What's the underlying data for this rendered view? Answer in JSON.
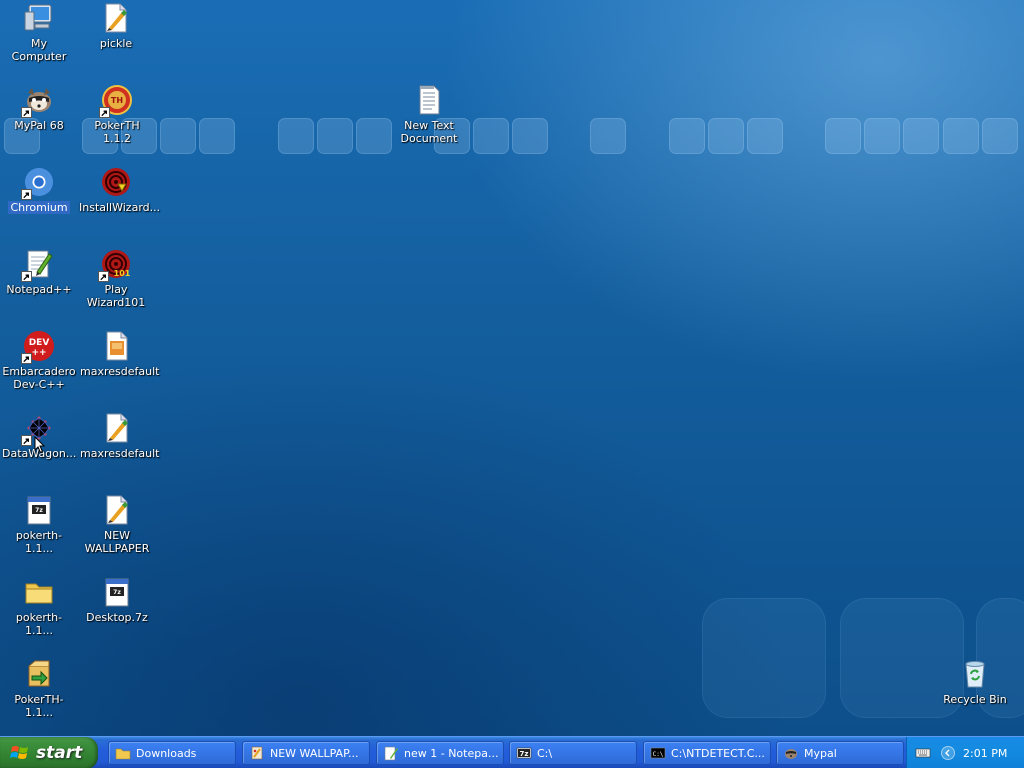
{
  "desktop": {
    "icons": [
      {
        "id": "my-computer",
        "label": "My Computer",
        "icon": "computer-icon",
        "shortcut": false,
        "selected": false
      },
      {
        "id": "pickle",
        "label": "pickle",
        "icon": "image-file-icon",
        "shortcut": false,
        "selected": false
      },
      {
        "id": "mypal",
        "label": "MyPal 68",
        "icon": "raccoon-icon",
        "shortcut": true,
        "selected": false
      },
      {
        "id": "pokerth",
        "label": "PokerTH 1.1.2",
        "icon": "pokerth-icon",
        "shortcut": true,
        "selected": false
      },
      {
        "id": "new-text-document",
        "label": "New Text\nDocument",
        "icon": "text-document-icon",
        "shortcut": false,
        "selected": false
      },
      {
        "id": "chromium",
        "label": "Chromium",
        "icon": "chromium-icon",
        "shortcut": true,
        "selected": true
      },
      {
        "id": "installwizard",
        "label": "InstallWizard...",
        "icon": "wizard-swirl-icon",
        "shortcut": false,
        "selected": false
      },
      {
        "id": "notepadpp",
        "label": "Notepad++",
        "icon": "notepadpp-icon",
        "shortcut": true,
        "selected": false
      },
      {
        "id": "playwizard",
        "label": "Play Wizard101",
        "icon": "wizard101-icon",
        "shortcut": true,
        "selected": false
      },
      {
        "id": "devcpp",
        "label": "Embarcadero\nDev-C++",
        "icon": "devcpp-icon",
        "shortcut": true,
        "selected": false
      },
      {
        "id": "maxres1",
        "label": "maxresdefault",
        "icon": "image-file-icon-2",
        "shortcut": false,
        "selected": false
      },
      {
        "id": "datawagon",
        "label": "DataWagon...",
        "icon": "datawagon-icon",
        "shortcut": true,
        "selected": false
      },
      {
        "id": "maxres2",
        "label": "maxresdefault",
        "icon": "image-file-icon",
        "shortcut": false,
        "selected": false
      },
      {
        "id": "pokerth-file1",
        "label": "pokerth-1.1...",
        "icon": "archive-file-icon",
        "shortcut": false,
        "selected": false
      },
      {
        "id": "new-wallpaper",
        "label": "NEW\nWALLPAPER",
        "icon": "image-file-icon",
        "shortcut": false,
        "selected": false
      },
      {
        "id": "pokerth-folder",
        "label": "pokerth-1.1...",
        "icon": "folder-icon",
        "shortcut": false,
        "selected": false
      },
      {
        "id": "desktop-7z",
        "label": "Desktop.7z",
        "icon": "archive-file-icon",
        "shortcut": false,
        "selected": false
      },
      {
        "id": "pokerth-installer",
        "label": "PokerTH-1.1...",
        "icon": "installer-icon",
        "shortcut": false,
        "selected": false
      },
      {
        "id": "recycle-bin",
        "label": "Recycle Bin",
        "icon": "recycle-bin-icon",
        "shortcut": false,
        "selected": false
      }
    ]
  },
  "taskbar": {
    "start_label": "start",
    "tasks": [
      {
        "label": "Downloads",
        "icon": "folder-icon"
      },
      {
        "label": "NEW WALLPAP...",
        "icon": "paint-icon"
      },
      {
        "label": "new 1 - Notepa...",
        "icon": "notepadpp-icon"
      },
      {
        "label": "C:\\",
        "icon": "7zip-icon"
      },
      {
        "label": "C:\\NTDETECT.C...",
        "icon": "console-icon"
      },
      {
        "label": "Mypal",
        "icon": "raccoon-icon"
      }
    ],
    "tray": {
      "clock": "2:01 PM"
    }
  },
  "colors": {
    "desktop_blue": "#145f9f",
    "taskbar_blue": "#245edb",
    "start_green": "#3c8f3c",
    "tray_blue": "#138be0",
    "selection": "#316ac5"
  }
}
